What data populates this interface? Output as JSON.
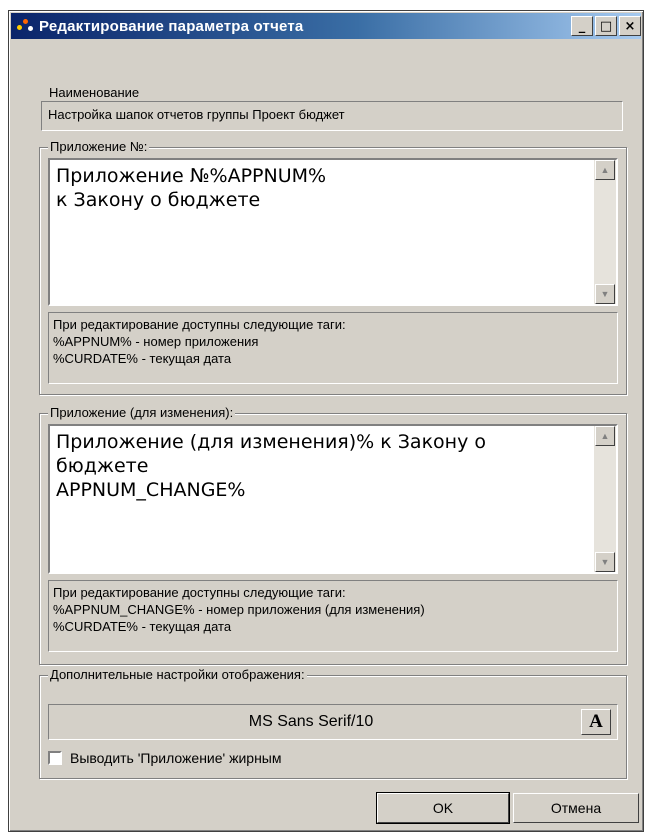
{
  "window": {
    "title": "Редактирование параметра отчета",
    "controls": {
      "minimize": "_",
      "maximize": "□",
      "close": "×"
    }
  },
  "name_field": {
    "label": "Наименование",
    "value": "Настройка шапок отчетов группы Проект бюджет"
  },
  "appendix_group": {
    "legend": "Приложение №:",
    "memo_value": "Приложение №%APPNUM%\nк Закону о бюджете",
    "hint_lines": [
      "При редактирование доступны следующие таги:",
      "%APPNUM% - номер приложения",
      "%CURDATE% - текущая дата"
    ]
  },
  "appendix_change_group": {
    "legend": "Приложение (для изменения):",
    "memo_value": "Приложение (для изменения)% к Закону о\nбюджете\nAPPNUM_CHANGE%",
    "hint_lines": [
      "При редактирование доступны следующие таги:",
      "%APPNUM_CHANGE% - номер приложения (для изменения)",
      "%CURDATE% - текущая дата"
    ]
  },
  "display_group": {
    "legend": "Дополнительные настройки отображения:",
    "font_value": "MS Sans Serif/10",
    "font_button_label": "A",
    "bold_checkbox_label": "Выводить 'Приложение' жирным",
    "bold_checked": false
  },
  "buttons": {
    "ok": "OK",
    "cancel": "Отмена"
  },
  "icons": {
    "app": "app-icon",
    "scroll_up": "scroll-up-arrow-icon",
    "scroll_down": "scroll-down-arrow-icon",
    "font": "font-icon"
  }
}
